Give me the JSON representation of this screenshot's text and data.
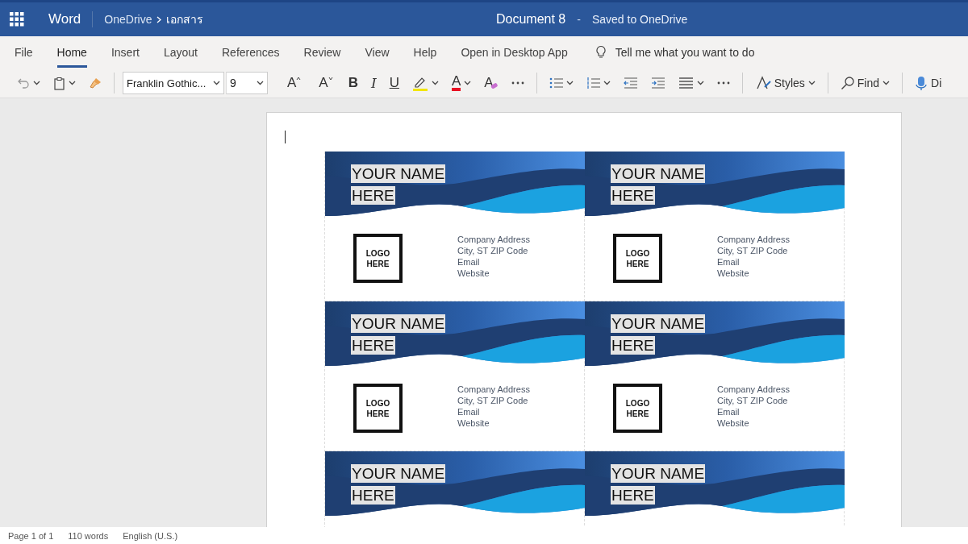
{
  "header": {
    "app_name": "Word",
    "breadcrumb": [
      "OneDrive",
      "เอกสาร"
    ],
    "doc_title": "Document 8",
    "separator": "-",
    "save_status": "Saved to OneDrive"
  },
  "ribbon_tabs": [
    {
      "label": "File",
      "selected": false
    },
    {
      "label": "Home",
      "selected": true
    },
    {
      "label": "Insert",
      "selected": false
    },
    {
      "label": "Layout",
      "selected": false
    },
    {
      "label": "References",
      "selected": false
    },
    {
      "label": "Review",
      "selected": false
    },
    {
      "label": "View",
      "selected": false
    },
    {
      "label": "Help",
      "selected": false
    },
    {
      "label": "Open in Desktop App",
      "selected": false
    }
  ],
  "tell_me": {
    "placeholder": "Tell me what you want to do"
  },
  "toolbar": {
    "font": "Franklin Gothic...",
    "size": "9",
    "buttons": [
      {
        "kind": "undo"
      },
      {
        "kind": "paste"
      },
      {
        "kind": "painter"
      },
      {
        "kind": "separator"
      },
      {
        "kind": "fields"
      },
      {
        "kind": "grow",
        "label": "A"
      },
      {
        "kind": "shrink",
        "label": "A"
      },
      {
        "kind": "bold",
        "label": "B"
      },
      {
        "kind": "italic",
        "label": "I"
      },
      {
        "kind": "underline",
        "label": "U"
      },
      {
        "kind": "highlight"
      },
      {
        "kind": "fontcolor",
        "label": "A"
      },
      {
        "kind": "clear",
        "label": "A"
      },
      {
        "kind": "more"
      },
      {
        "kind": "separator"
      },
      {
        "kind": "bullets"
      },
      {
        "kind": "numbering"
      },
      {
        "kind": "outdent"
      },
      {
        "kind": "indent"
      },
      {
        "kind": "align"
      },
      {
        "kind": "more"
      },
      {
        "kind": "separator"
      },
      {
        "kind": "styles",
        "label": "Styles"
      },
      {
        "kind": "separator"
      },
      {
        "kind": "find",
        "label": "Find"
      },
      {
        "kind": "separator"
      },
      {
        "kind": "dictate",
        "label": "Di"
      }
    ]
  },
  "labels": [
    {
      "name": [
        "YOUR NAME",
        "HERE"
      ],
      "logo": [
        "LOGO",
        "HERE"
      ],
      "address": [
        "Company Address",
        "City, ST  ZIP Code",
        "Email",
        "Website"
      ]
    },
    {
      "name": [
        "YOUR NAME",
        "HERE"
      ],
      "logo": [
        "LOGO",
        "HERE"
      ],
      "address": [
        "Company Address",
        "City, ST  ZIP Code",
        "Email",
        "Website"
      ]
    },
    {
      "name": [
        "YOUR NAME",
        "HERE"
      ],
      "logo": [
        "LOGO",
        "HERE"
      ],
      "address": [
        "Company Address",
        "City, ST  ZIP Code",
        "Email",
        "Website"
      ]
    },
    {
      "name": [
        "YOUR NAME",
        "HERE"
      ],
      "logo": [
        "LOGO",
        "HERE"
      ],
      "address": [
        "Company Address",
        "City, ST  ZIP Code",
        "Email",
        "Website"
      ]
    },
    {
      "name": [
        "YOUR NAME",
        "HERE"
      ]
    },
    {
      "name": [
        "YOUR NAME",
        "HERE"
      ]
    }
  ],
  "status_bar": [
    "Page 1 of 1",
    "110 words",
    "English (U.S.)"
  ]
}
